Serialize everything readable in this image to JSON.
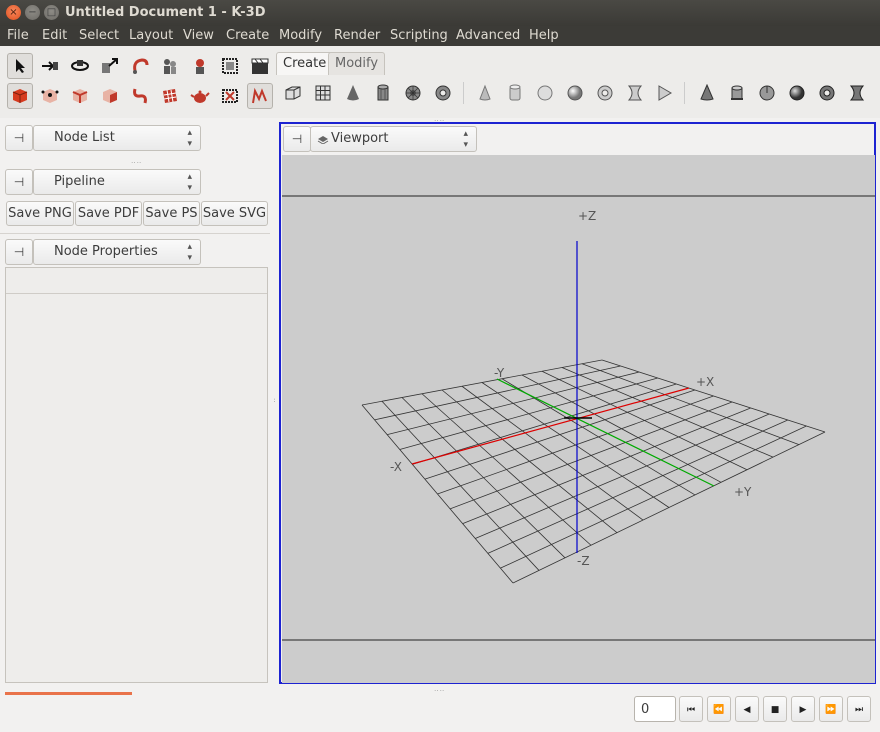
{
  "window": {
    "title": "Untitled Document 1 - K-3D",
    "close": "×",
    "minimize": "−",
    "maximize": "□"
  },
  "menu": [
    "File",
    "Edit",
    "Select",
    "Layout",
    "View",
    "Create",
    "Modify",
    "Render",
    "Scripting",
    "Advanced",
    "Help"
  ],
  "tabs": {
    "create": "Create",
    "modify": "Modify"
  },
  "panels": {
    "node_list": "Node List",
    "pipeline": "Pipeline",
    "node_properties": "Node Properties",
    "viewport": "Viewport"
  },
  "save_buttons": [
    "Save PNG",
    "Save PDF",
    "Save PS",
    "Save SVG"
  ],
  "axes": {
    "pz": "+Z",
    "nz": "-Z",
    "px": "+X",
    "nx": "-X",
    "py": "+Y",
    "ny": "-Y"
  },
  "playback": {
    "frame": "0",
    "buttons": [
      "⏮",
      "⏪",
      "◀",
      "■",
      "▶",
      "⏩",
      "⏭"
    ]
  },
  "colors": {
    "viewport_border": "#1d23d1",
    "x_axis": "#dd0000",
    "y_axis": "#00aa00",
    "z_axis": "#0000cc",
    "progress": "#e9734a"
  }
}
